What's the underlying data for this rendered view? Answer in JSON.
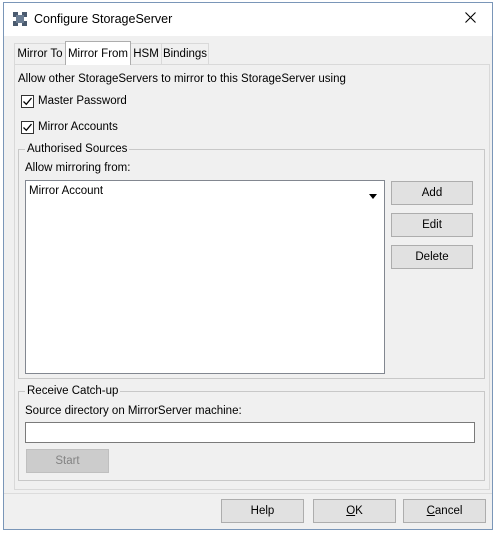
{
  "window": {
    "title": "Configure StorageServer"
  },
  "icons": {
    "app": "storage-server-icon",
    "close": "close-icon",
    "dropdown": "dropdown-arrow-icon",
    "checkmark": "checkmark-icon"
  },
  "tabs": [
    {
      "label": "Mirror To",
      "active": false
    },
    {
      "label": "Mirror From",
      "active": true
    },
    {
      "label": "HSM",
      "active": false
    },
    {
      "label": "Bindings",
      "active": false
    }
  ],
  "mirror_from": {
    "intro": "Allow other StorageServers to mirror to this  StorageServer using",
    "master_password": {
      "label": "Master Password",
      "checked": true
    },
    "mirror_accounts": {
      "label": "Mirror Accounts",
      "checked": true
    },
    "authorised_sources": {
      "title": "Authorised Sources",
      "allow_label": "Allow mirroring from:",
      "list_header": "Mirror Account",
      "buttons": {
        "add": "Add",
        "edit": "Edit",
        "delete": "Delete"
      }
    },
    "receive_catchup": {
      "title": "Receive Catch-up",
      "source_label": "Source directory on MirrorServer machine:",
      "source_value": "",
      "start_label": "Start"
    }
  },
  "footer": {
    "help": "Help",
    "ok_prefix": "",
    "ok_mnemonic": "O",
    "ok_suffix": "K",
    "cancel_prefix": "",
    "cancel_mnemonic": "C",
    "cancel_suffix": "ancel"
  }
}
